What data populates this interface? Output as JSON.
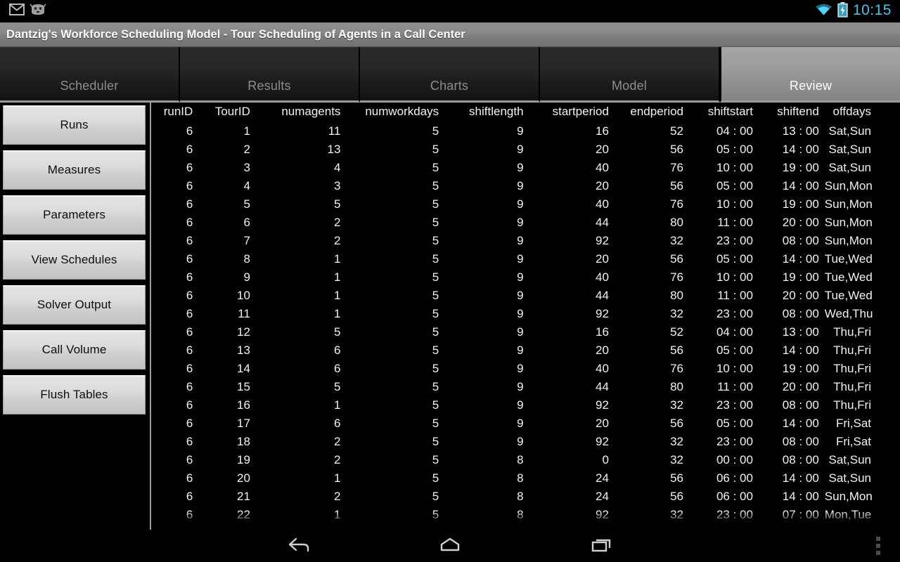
{
  "statusbar": {
    "icons_left": [
      "email-icon",
      "android-mascot-icon"
    ],
    "icons_right": [
      "wifi-icon",
      "battery-charging-icon"
    ],
    "clock": "10:15",
    "clock_color": "#3fc6e8"
  },
  "titlebar": {
    "title": "Dantzig's Workforce Scheduling Model - Tour Scheduling of Agents in a Call Center"
  },
  "tabs": [
    {
      "label": "Scheduler",
      "active": false
    },
    {
      "label": "Results",
      "active": false
    },
    {
      "label": "Charts",
      "active": false
    },
    {
      "label": "Model",
      "active": false
    },
    {
      "label": "Review",
      "active": true
    }
  ],
  "sidebar": {
    "items": [
      {
        "label": "Runs"
      },
      {
        "label": "Measures"
      },
      {
        "label": "Parameters"
      },
      {
        "label": "View Schedules"
      },
      {
        "label": "Solver Output"
      },
      {
        "label": "Call Volume"
      },
      {
        "label": "Flush Tables"
      }
    ]
  },
  "table": {
    "columns": [
      "runID",
      "TourID",
      "numagents",
      "numworkdays",
      "shiftlength",
      "startperiod",
      "endperiod",
      "shiftstart",
      "shiftend",
      "offdays"
    ],
    "rows": [
      [
        "6",
        "1",
        "11",
        "5",
        "9",
        "16",
        "52",
        "04 : 00",
        "13 : 00",
        "Sat,Sun"
      ],
      [
        "6",
        "2",
        "13",
        "5",
        "9",
        "20",
        "56",
        "05 : 00",
        "14 : 00",
        "Sat,Sun"
      ],
      [
        "6",
        "3",
        "4",
        "5",
        "9",
        "40",
        "76",
        "10 : 00",
        "19 : 00",
        "Sat,Sun"
      ],
      [
        "6",
        "4",
        "3",
        "5",
        "9",
        "20",
        "56",
        "05 : 00",
        "14 : 00",
        "Sun,Mon"
      ],
      [
        "6",
        "5",
        "5",
        "5",
        "9",
        "40",
        "76",
        "10 : 00",
        "19 : 00",
        "Sun,Mon"
      ],
      [
        "6",
        "6",
        "2",
        "5",
        "9",
        "44",
        "80",
        "11 : 00",
        "20 : 00",
        "Sun,Mon"
      ],
      [
        "6",
        "7",
        "2",
        "5",
        "9",
        "92",
        "32",
        "23 : 00",
        "08 : 00",
        "Sun,Mon"
      ],
      [
        "6",
        "8",
        "1",
        "5",
        "9",
        "20",
        "56",
        "05 : 00",
        "14 : 00",
        "Tue,Wed"
      ],
      [
        "6",
        "9",
        "1",
        "5",
        "9",
        "40",
        "76",
        "10 : 00",
        "19 : 00",
        "Tue,Wed"
      ],
      [
        "6",
        "10",
        "1",
        "5",
        "9",
        "44",
        "80",
        "11 : 00",
        "20 : 00",
        "Tue,Wed"
      ],
      [
        "6",
        "11",
        "1",
        "5",
        "9",
        "92",
        "32",
        "23 : 00",
        "08 : 00",
        "Wed,Thu"
      ],
      [
        "6",
        "12",
        "5",
        "5",
        "9",
        "16",
        "52",
        "04 : 00",
        "13 : 00",
        "Thu,Fri"
      ],
      [
        "6",
        "13",
        "6",
        "5",
        "9",
        "20",
        "56",
        "05 : 00",
        "14 : 00",
        "Thu,Fri"
      ],
      [
        "6",
        "14",
        "6",
        "5",
        "9",
        "40",
        "76",
        "10 : 00",
        "19 : 00",
        "Thu,Fri"
      ],
      [
        "6",
        "15",
        "5",
        "5",
        "9",
        "44",
        "80",
        "11 : 00",
        "20 : 00",
        "Thu,Fri"
      ],
      [
        "6",
        "16",
        "1",
        "5",
        "9",
        "92",
        "32",
        "23 : 00",
        "08 : 00",
        "Thu,Fri"
      ],
      [
        "6",
        "17",
        "6",
        "5",
        "9",
        "20",
        "56",
        "05 : 00",
        "14 : 00",
        "Fri,Sat"
      ],
      [
        "6",
        "18",
        "2",
        "5",
        "9",
        "92",
        "32",
        "23 : 00",
        "08 : 00",
        "Fri,Sat"
      ],
      [
        "6",
        "19",
        "2",
        "5",
        "8",
        "0",
        "32",
        "00 : 00",
        "08 : 00",
        "Sat,Sun"
      ],
      [
        "6",
        "20",
        "1",
        "5",
        "8",
        "24",
        "56",
        "06 : 00",
        "14 : 00",
        "Sat,Sun"
      ],
      [
        "6",
        "21",
        "2",
        "5",
        "8",
        "24",
        "56",
        "06 : 00",
        "14 : 00",
        "Sun,Mon"
      ],
      [
        "6",
        "22",
        "1",
        "5",
        "8",
        "92",
        "32",
        "23 : 00",
        "07 : 00",
        "Mon,Tue"
      ]
    ]
  },
  "navbar": {
    "back_label": "back-icon",
    "home_label": "home-icon",
    "recents_label": "recents-icon",
    "overflow_label": "overflow-menu"
  }
}
